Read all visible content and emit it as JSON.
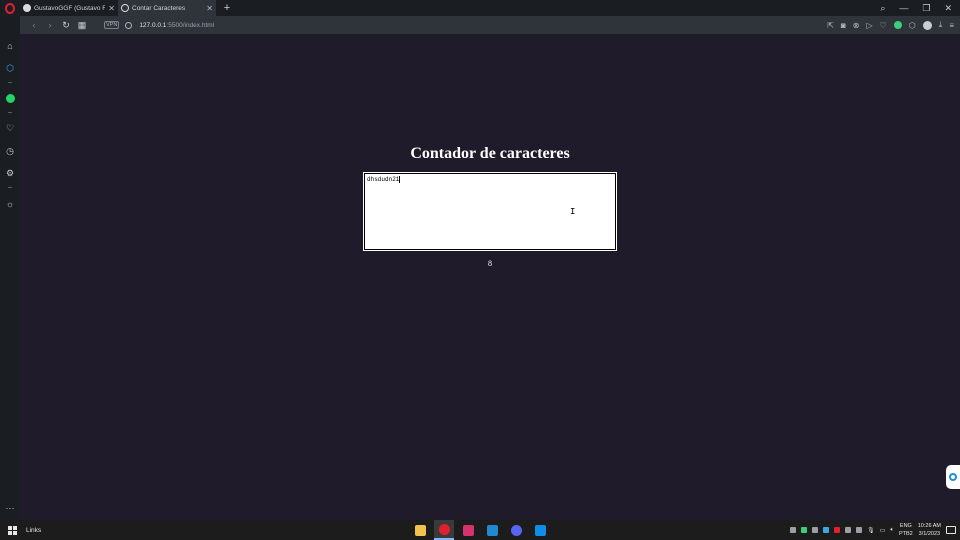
{
  "browser": {
    "tabs": [
      {
        "title": "GustavoGGF (Gustavo Freit",
        "icon": "github-icon",
        "active": false
      },
      {
        "title": "Contar Caracteres",
        "icon": "globe-icon",
        "active": true
      }
    ],
    "new_tab_symbol": "+",
    "window_controls": {
      "search": "⌕",
      "minimize": "—",
      "restore": "❐",
      "close": "✕"
    },
    "nav": {
      "back": "‹",
      "forward": "›",
      "reload": "↻",
      "tabs_grid": "▦"
    },
    "vpn_label": "VPN",
    "url_host": "127.0.0.1",
    "url_path": ":5500/index.html",
    "tools": [
      "share-icon",
      "camera-icon",
      "close-circle-icon",
      "play-icon",
      "heart-icon",
      "extension-icon",
      "cube-icon",
      "profile-icon",
      "download-icon",
      "menu-icon"
    ]
  },
  "sidebar": {
    "items": [
      "home-icon",
      "speed-dial-icon",
      "whatsapp-icon",
      "heart-icon",
      "history-icon",
      "settings-icon",
      "lightbulb-icon"
    ],
    "more": "···"
  },
  "page": {
    "heading": "Contador de caracteres",
    "textarea_value": "dhsdudn21",
    "count": "8"
  },
  "taskbar": {
    "links_label": "Links",
    "apps": [
      "file-explorer-icon",
      "opera-icon",
      "instagram-icon",
      "vscode-icon",
      "discord-icon",
      "teamviewer-icon"
    ],
    "language_top": "ENG",
    "language_bottom": "PTB2",
    "time": "10:26 AM",
    "date": "3/1/2023"
  },
  "colors": {
    "page_background": "#1f1b2b",
    "chrome_dark": "#1a1d22",
    "chrome_light": "#2f343b",
    "opera_red": "#e0202e",
    "taskbar": "#1c1c1c"
  }
}
